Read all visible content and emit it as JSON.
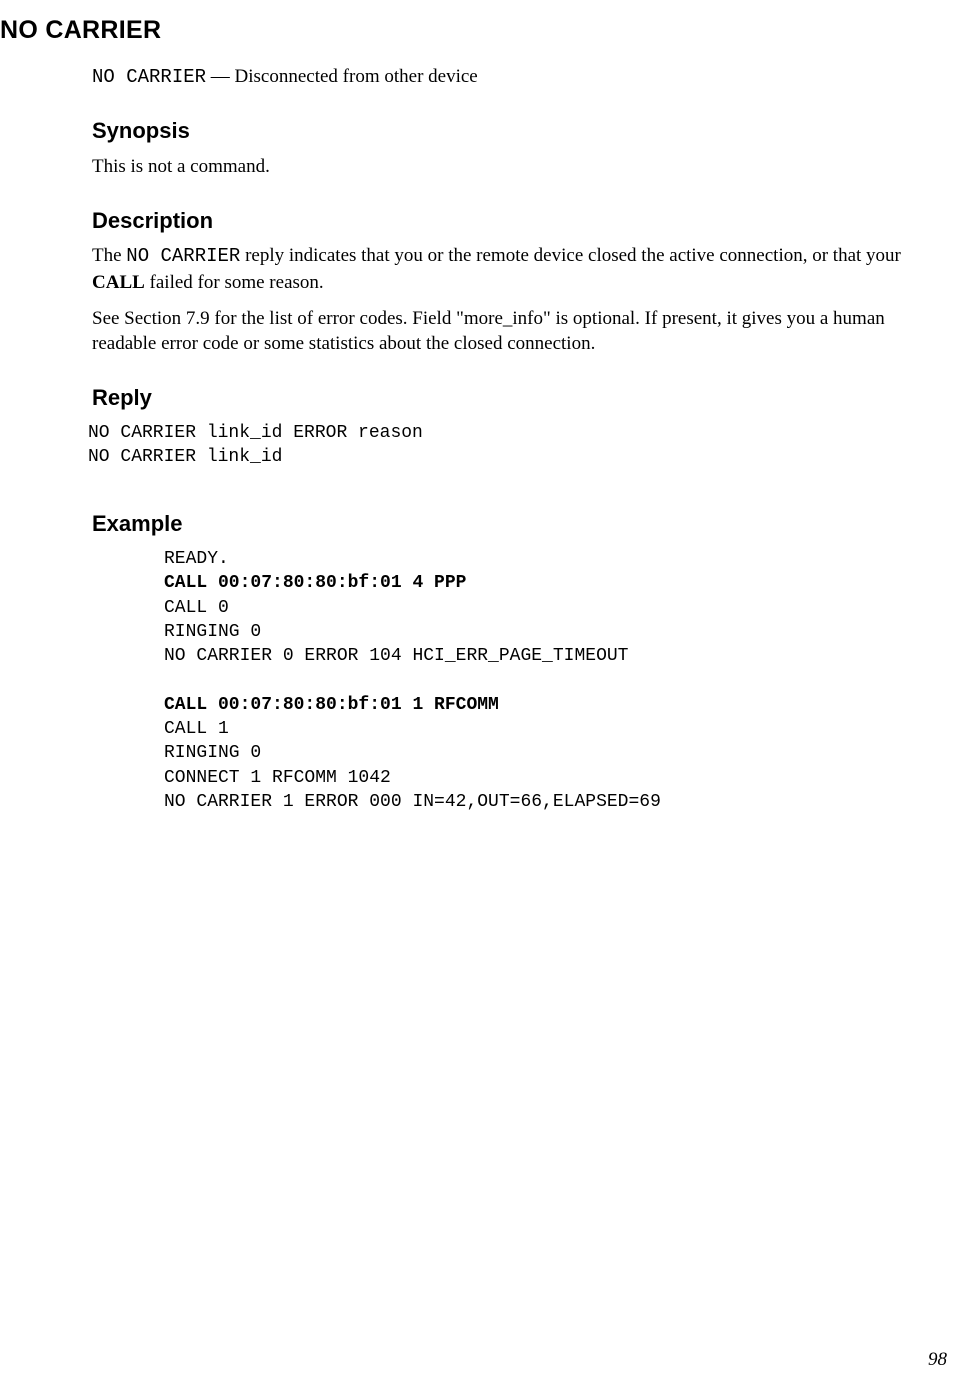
{
  "title": "NO CARRIER",
  "purpose": {
    "cmd": "NO CARRIER",
    "sep": " — ",
    "desc": "Disconnected from other device"
  },
  "sections": {
    "synopsis": {
      "heading": "Synopsis",
      "text": "This is not a command."
    },
    "description": {
      "heading": "Description",
      "para1_prefix": "The ",
      "para1_cmd": "NO CARRIER",
      "para1_mid": " reply indicates that you or the remote device closed the active connection, or that your ",
      "para1_bold": "CALL",
      "para1_suffix": " failed for some reason.",
      "para2": "See Section 7.9 for the list of error codes. Field \"more_info\" is optional. If present, it gives you a human readable error code or some statistics about the closed connection."
    },
    "reply": {
      "heading": "Reply",
      "line1": "NO CARRIER link_id ERROR reason",
      "line2": "NO CARRIER link_id"
    },
    "example": {
      "heading": "Example",
      "line1": "READY.",
      "line2_bold": "CALL 00:07:80:80:bf:01 4 PPP",
      "line3": "CALL 0",
      "line4": "RINGING 0",
      "line5": "NO CARRIER 0 ERROR 104 HCI_ERR_PAGE_TIMEOUT",
      "line6_bold": "CALL 00:07:80:80:bf:01 1 RFCOMM",
      "line7": "CALL 1",
      "line8": "RINGING 0",
      "line9": "CONNECT 1 RFCOMM 1042",
      "line10": "NO CARRIER 1 ERROR 000 IN=42,OUT=66,ELAPSED=69"
    }
  },
  "page_number": "98"
}
